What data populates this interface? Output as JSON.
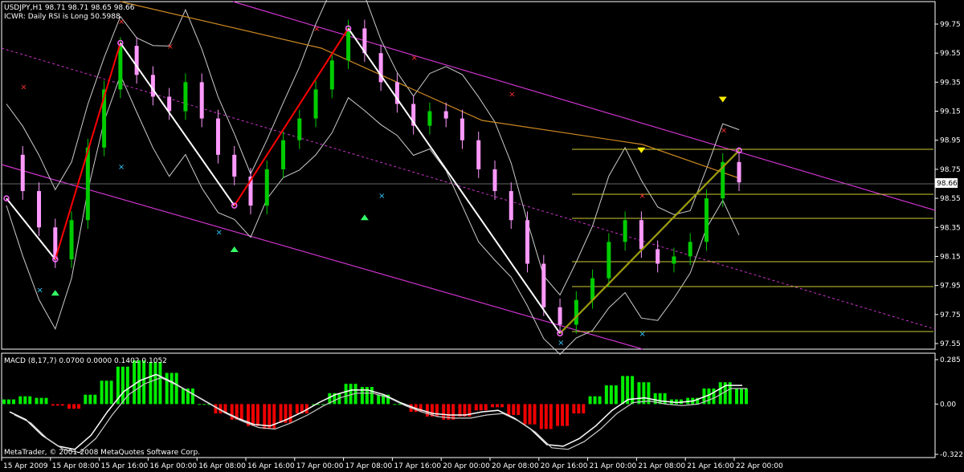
{
  "header": {
    "symbol_line": "USDJPY,H1  98.71 98.71 98.65 98.66",
    "indicator_line": "ICWR: Daily RSI is Long 50.5988"
  },
  "macd_panel": {
    "label": "MACD  (8,17,7) 0.0700 0.0000 0.1402 0.1052"
  },
  "footer": {
    "copyright": "MetaTrader, © 2001-2008 MetaQuotes Software Corp."
  },
  "colors": {
    "background": "#000000",
    "bull_candle": "#00cc00",
    "bear_candle": "#ff99ff",
    "channel": "#cc33cc",
    "zigzag": "#ffffff",
    "zigzag_red": "#ff0000",
    "fib": "#cccc33",
    "ma": "#cc8822",
    "hist_pos": "#00ee00",
    "hist_neg": "#ee0000",
    "price_box": "#ffffff"
  },
  "chart_data": {
    "type": "candlestick",
    "symbol": "USDJPY,H1",
    "current_price": "98.66",
    "price_ticks": [
      "99.75",
      "99.55",
      "99.35",
      "99.15",
      "98.95",
      "98.75",
      "98.55",
      "98.35",
      "98.15",
      "97.95",
      "97.75",
      "97.55"
    ],
    "time_ticks": [
      "15 Apr 2009",
      "15 Apr 08:00",
      "15 Apr 16:00",
      "16 Apr 00:00",
      "16 Apr 08:00",
      "16 Apr 16:00",
      "17 Apr 00:00",
      "17 Apr 08:00",
      "17 Apr 16:00",
      "20 Apr 00:00",
      "20 Apr 08:00",
      "20 Apr 16:00",
      "21 Apr 00:00",
      "21 Apr 08:00",
      "21 Apr 16:00",
      "22 Apr 00:00"
    ],
    "price_path": [
      98.85,
      98.6,
      98.35,
      98.13,
      98.4,
      98.9,
      99.3,
      99.6,
      99.4,
      99.25,
      99.15,
      99.35,
      99.1,
      98.85,
      98.7,
      98.5,
      98.75,
      98.95,
      99.1,
      99.3,
      99.5,
      99.72,
      99.55,
      99.35,
      99.2,
      99.05,
      99.15,
      99.1,
      98.95,
      98.75,
      98.6,
      98.4,
      98.1,
      97.8,
      97.68,
      97.85,
      98.0,
      98.25,
      98.4,
      98.2,
      98.1,
      98.15,
      98.25,
      98.55,
      98.8,
      98.66
    ],
    "zigzag_points": [
      [
        0,
        98.55
      ],
      [
        3,
        98.13
      ],
      [
        7,
        99.62
      ],
      [
        14,
        98.5
      ],
      [
        21,
        99.72
      ],
      [
        34,
        97.62
      ],
      [
        45,
        98.88
      ]
    ],
    "macd_ticks": [
      "0.285",
      "0.00",
      "-0.322"
    ],
    "macd_hist": [
      0.03,
      0.05,
      0.04,
      -0.01,
      -0.03,
      0.06,
      0.15,
      0.24,
      0.28,
      0.27,
      0.2,
      0.1,
      0.0,
      -0.06,
      -0.1,
      -0.14,
      -0.16,
      -0.12,
      -0.06,
      0.0,
      0.07,
      0.13,
      0.11,
      0.06,
      0.0,
      -0.05,
      -0.08,
      -0.1,
      -0.08,
      -0.04,
      -0.02,
      -0.07,
      -0.13,
      -0.16,
      -0.14,
      -0.06,
      0.05,
      0.12,
      0.18,
      0.14,
      0.07,
      0.03,
      0.04,
      0.1,
      0.14,
      0.1
    ],
    "macd_signal": [
      -0.05,
      -0.1,
      -0.2,
      -0.27,
      -0.29,
      -0.2,
      -0.05,
      0.08,
      0.15,
      0.19,
      0.14,
      0.08,
      0.02,
      -0.04,
      -0.09,
      -0.13,
      -0.14,
      -0.1,
      -0.05,
      0.01,
      0.06,
      0.09,
      0.09,
      0.06,
      0.01,
      -0.03,
      -0.06,
      -0.07,
      -0.07,
      -0.05,
      -0.04,
      -0.09,
      -0.16,
      -0.26,
      -0.27,
      -0.22,
      -0.14,
      -0.04,
      0.03,
      0.04,
      0.02,
      0.01,
      0.02,
      0.06,
      0.12,
      0.12
    ]
  }
}
